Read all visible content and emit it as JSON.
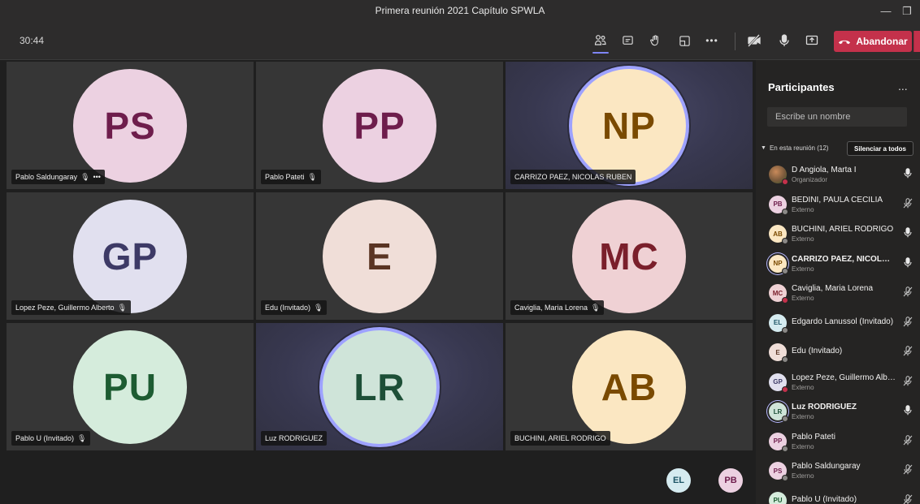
{
  "window": {
    "title": "Primera reunión 2021 Capítulo SPWLA"
  },
  "toolbar": {
    "timer": "30:44",
    "leave_label": "Abandonar",
    "icons": [
      "participants-icon",
      "chat-icon",
      "raise-hand-icon",
      "rooms-icon",
      "more-icon",
      "camera-off-icon",
      "microphone-icon",
      "share-icon",
      "phone-hangup-icon"
    ]
  },
  "tiles": [
    {
      "initials": "PS",
      "name": "Pablo Saldungaray",
      "muted": true,
      "more": "•••",
      "bg": "#ecd1e1",
      "fg": "#6e1d4c",
      "speaking": false
    },
    {
      "initials": "PP",
      "name": "Pablo Pateti",
      "muted": true,
      "bg": "#ecd1e1",
      "fg": "#6e1d4c",
      "speaking": false
    },
    {
      "initials": "NP",
      "name": "CARRIZO PAEZ, NICOLAS RUBEN",
      "muted": false,
      "bg": "#fbe7c2",
      "fg": "#7a4a00",
      "speaking": true
    },
    {
      "initials": "GP",
      "name": "Lopez Peze, Guillermo Alberto",
      "muted": true,
      "bg": "#e1e0ef",
      "fg": "#3d3a66",
      "speaking": false
    },
    {
      "initials": "E",
      "name": "Edu (Invitado)",
      "muted": true,
      "bg": "#f0ded8",
      "fg": "#5a3423",
      "speaking": false
    },
    {
      "initials": "MC",
      "name": "Caviglia, Maria Lorena",
      "muted": true,
      "bg": "#efd1d4",
      "fg": "#7a1f2b",
      "speaking": false
    },
    {
      "initials": "PU",
      "name": "Pablo U (Invitado)",
      "muted": true,
      "bg": "#d5ecdc",
      "fg": "#1d5c32",
      "speaking": false
    },
    {
      "initials": "LR",
      "name": "Luz RODRIGUEZ",
      "muted": false,
      "bg": "#cfe4d9",
      "fg": "#1d4f37",
      "speaking": true
    },
    {
      "initials": "AB",
      "name": "BUCHINI, ARIEL RODRIGO",
      "muted": false,
      "bg": "#fbe7c2",
      "fg": "#7a4a00",
      "speaking": false
    }
  ],
  "overflow": [
    {
      "initials": "EL",
      "bg": "#d5ebf0",
      "fg": "#1d5566"
    },
    {
      "initials": "PB",
      "bg": "#ecd1e1",
      "fg": "#6e1d4c"
    }
  ],
  "panel": {
    "title": "Participantes",
    "more": "...",
    "search_placeholder": "Escribe un nombre",
    "section_label": "En esta reunión (12)",
    "mute_all_label": "Silenciar a todos",
    "participants": [
      {
        "initials": "",
        "name": "D Angiola, Marta I",
        "role": "Organizador",
        "photo": true,
        "bg": "#7a5a3c",
        "fg": "#ffffff",
        "mic": "on",
        "dot": "red",
        "bold": false,
        "ring": false
      },
      {
        "initials": "PB",
        "name": "BEDINI, PAULA CECILIA",
        "role": "Externo",
        "bg": "#ecd1e1",
        "fg": "#6e1d4c",
        "mic": "off",
        "dot": "grey",
        "bold": false,
        "ring": false
      },
      {
        "initials": "AB",
        "name": "BUCHINI, ARIEL RODRIGO",
        "role": "Externo",
        "bg": "#fbe7c2",
        "fg": "#7a4a00",
        "mic": "on",
        "dot": "grey",
        "bold": false,
        "ring": false
      },
      {
        "initials": "NP",
        "name": "CARRIZO PAEZ, NICOLAS ...",
        "role": "Externo",
        "bg": "#fbe7c2",
        "fg": "#7a4a00",
        "mic": "on",
        "dot": "grey",
        "bold": true,
        "ring": true
      },
      {
        "initials": "MC",
        "name": "Caviglia, Maria Lorena",
        "role": "Externo",
        "bg": "#efd1d4",
        "fg": "#7a1f2b",
        "mic": "off",
        "dot": "red",
        "bold": false,
        "ring": false
      },
      {
        "initials": "EL",
        "name": "Edgardo Lanussol (Invitado)",
        "role": "",
        "bg": "#d5ebf0",
        "fg": "#1d5566",
        "mic": "off",
        "dot": "grey",
        "bold": false,
        "ring": false
      },
      {
        "initials": "E",
        "name": "Edu (Invitado)",
        "role": "",
        "bg": "#f0ded8",
        "fg": "#5a3423",
        "mic": "off",
        "dot": "grey",
        "bold": false,
        "ring": false
      },
      {
        "initials": "GP",
        "name": "Lopez Peze, Guillermo Albe...",
        "role": "Externo",
        "bg": "#e1e0ef",
        "fg": "#3d3a66",
        "mic": "off",
        "dot": "red",
        "bold": false,
        "ring": false
      },
      {
        "initials": "LR",
        "name": "Luz RODRIGUEZ",
        "role": "Externo",
        "bg": "#cfe4d9",
        "fg": "#1d4f37",
        "mic": "on",
        "dot": "grey",
        "bold": true,
        "ring": true
      },
      {
        "initials": "PP",
        "name": "Pablo Pateti",
        "role": "Externo",
        "bg": "#ecd1e1",
        "fg": "#6e1d4c",
        "mic": "off",
        "dot": "grey",
        "bold": false,
        "ring": false
      },
      {
        "initials": "PS",
        "name": "Pablo Saldungaray",
        "role": "Externo",
        "bg": "#ecd1e1",
        "fg": "#6e1d4c",
        "mic": "off",
        "dot": "grey",
        "bold": false,
        "ring": false
      },
      {
        "initials": "PU",
        "name": "Pablo U (Invitado)",
        "role": "",
        "bg": "#d5ecdc",
        "fg": "#1d5c32",
        "mic": "off",
        "dot": "grey",
        "bold": false,
        "ring": false
      }
    ]
  }
}
